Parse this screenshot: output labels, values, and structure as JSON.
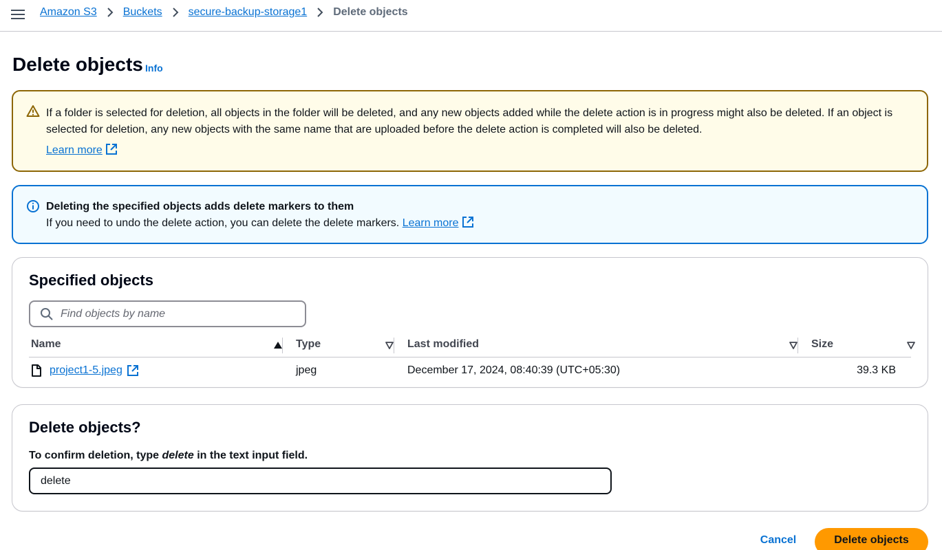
{
  "breadcrumb": {
    "items": [
      "Amazon S3",
      "Buckets",
      "secure-backup-storage1"
    ],
    "current": "Delete objects"
  },
  "page": {
    "title": "Delete objects",
    "info_link": "Info"
  },
  "warning_alert": {
    "text": "If a folder is selected for deletion, all objects in the folder will be deleted, and any new objects added while the delete action is in progress might also be deleted. If an object is selected for deletion, any new objects with the same name that are uploaded before the delete action is completed will also be deleted.",
    "link": "Learn more"
  },
  "info_alert": {
    "heading": "Deleting the specified objects adds delete markers to them",
    "text": "If you need to undo the delete action, you can delete the delete markers.",
    "link": "Learn more"
  },
  "specified_objects": {
    "title": "Specified objects",
    "search_placeholder": "Find objects by name",
    "columns": [
      "Name",
      "Type",
      "Last modified",
      "Size"
    ],
    "rows": [
      {
        "name": "project1-5.jpeg",
        "type": "jpeg",
        "last_modified": "December 17, 2024, 08:40:39 (UTC+05:30)",
        "size": "39.3 KB"
      }
    ]
  },
  "confirm": {
    "title": "Delete objects?",
    "label_prefix": "To confirm deletion, type ",
    "label_keyword": "delete",
    "label_suffix": " in the text input field.",
    "input_value": "delete"
  },
  "actions": {
    "cancel": "Cancel",
    "delete": "Delete objects"
  },
  "colors": {
    "link": "#0972d3",
    "primary_button": "#ff9900",
    "warning_border": "#8d6605",
    "warning_bg": "#fffce9",
    "info_border": "#0972d3",
    "info_bg": "#f2fbff"
  }
}
